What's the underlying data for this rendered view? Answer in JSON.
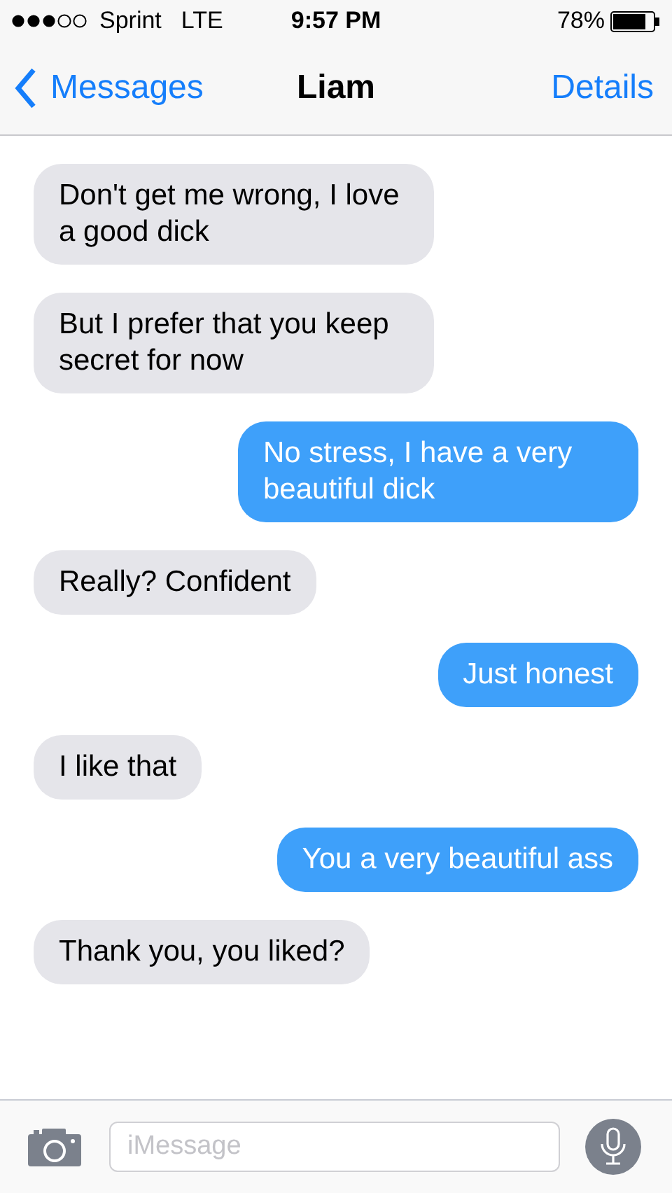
{
  "status_bar": {
    "carrier": "Sprint",
    "network": "LTE",
    "time": "9:57 PM",
    "battery": "78%"
  },
  "nav": {
    "back": "Messages",
    "title": "Liam",
    "action": "Details"
  },
  "messages": [
    {
      "kind": "received",
      "text": "Don't get me wrong, I love a good dick"
    },
    {
      "kind": "received",
      "text": "But I prefer that you keep secret for now"
    },
    {
      "kind": "sent",
      "text": "No stress, I have a very beautiful dick"
    },
    {
      "kind": "received",
      "text": "Really? Confident"
    },
    {
      "kind": "sent",
      "text": "Just honest"
    },
    {
      "kind": "received",
      "text": "I like that"
    },
    {
      "kind": "sent",
      "text": "You a very beautiful ass"
    },
    {
      "kind": "received",
      "text": "Thank you, you liked?"
    }
  ],
  "composer": {
    "placeholder": "iMessage"
  }
}
